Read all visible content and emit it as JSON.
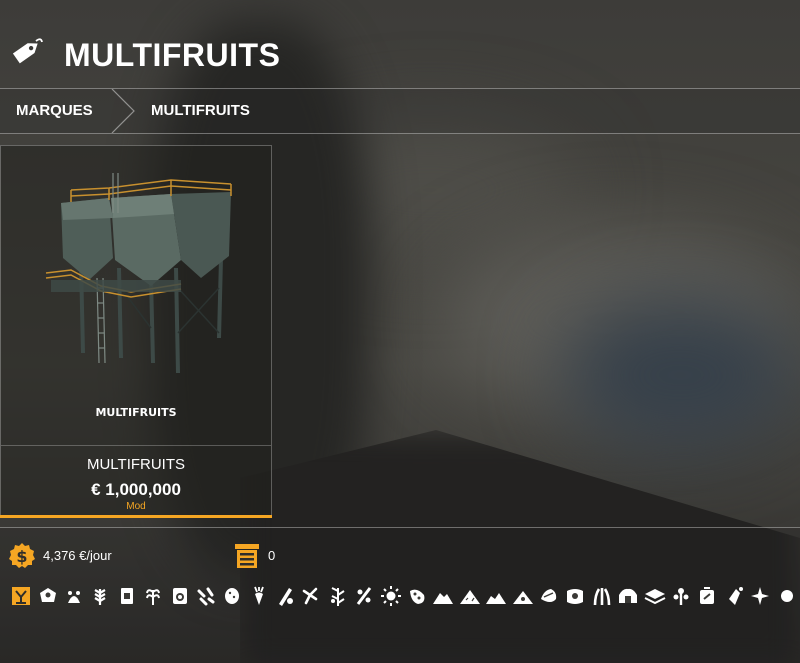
{
  "header": {
    "title": "MULTIFRUITS",
    "icon": "price-tag-icon"
  },
  "breadcrumb": {
    "items": [
      "MARQUES",
      "MULTIFRUITS"
    ]
  },
  "item": {
    "brand_caption": "MULTIFRUITS",
    "name": "MULTIFRUITS",
    "price": "€ 1,000,000",
    "source_label": "Mod"
  },
  "stats": {
    "income": {
      "icon": "money-icon",
      "value": "4,376 €/jour"
    },
    "capacity": {
      "icon": "silo-storage-icon",
      "value": "0"
    }
  },
  "fill_types": [
    "selected-fill-icon",
    "wheat-grain-icon",
    "barley-icon",
    "oat-icon",
    "canola-icon",
    "sunflower-seed-icon",
    "soybean-icon",
    "corn-icon",
    "potato-icon",
    "sugarbeet-icon",
    "sugarcane-icon",
    "cotton-icon",
    "sorghum-icon",
    "grape-icon",
    "olive-icon",
    "poplar-icon",
    "sunflower-icon",
    "beans-icon",
    "chaff-icon",
    "silage-icon",
    "grass-icon",
    "straw-icon",
    "hay-icon",
    "seeds-icon",
    "tree-sapling-icon",
    "hops-icon",
    "lettuce-icon",
    "onion-icon",
    "fertilizer-icon",
    "lime-icon"
  ],
  "colors": {
    "accent": "#f5a623",
    "text": "#ffffff"
  }
}
